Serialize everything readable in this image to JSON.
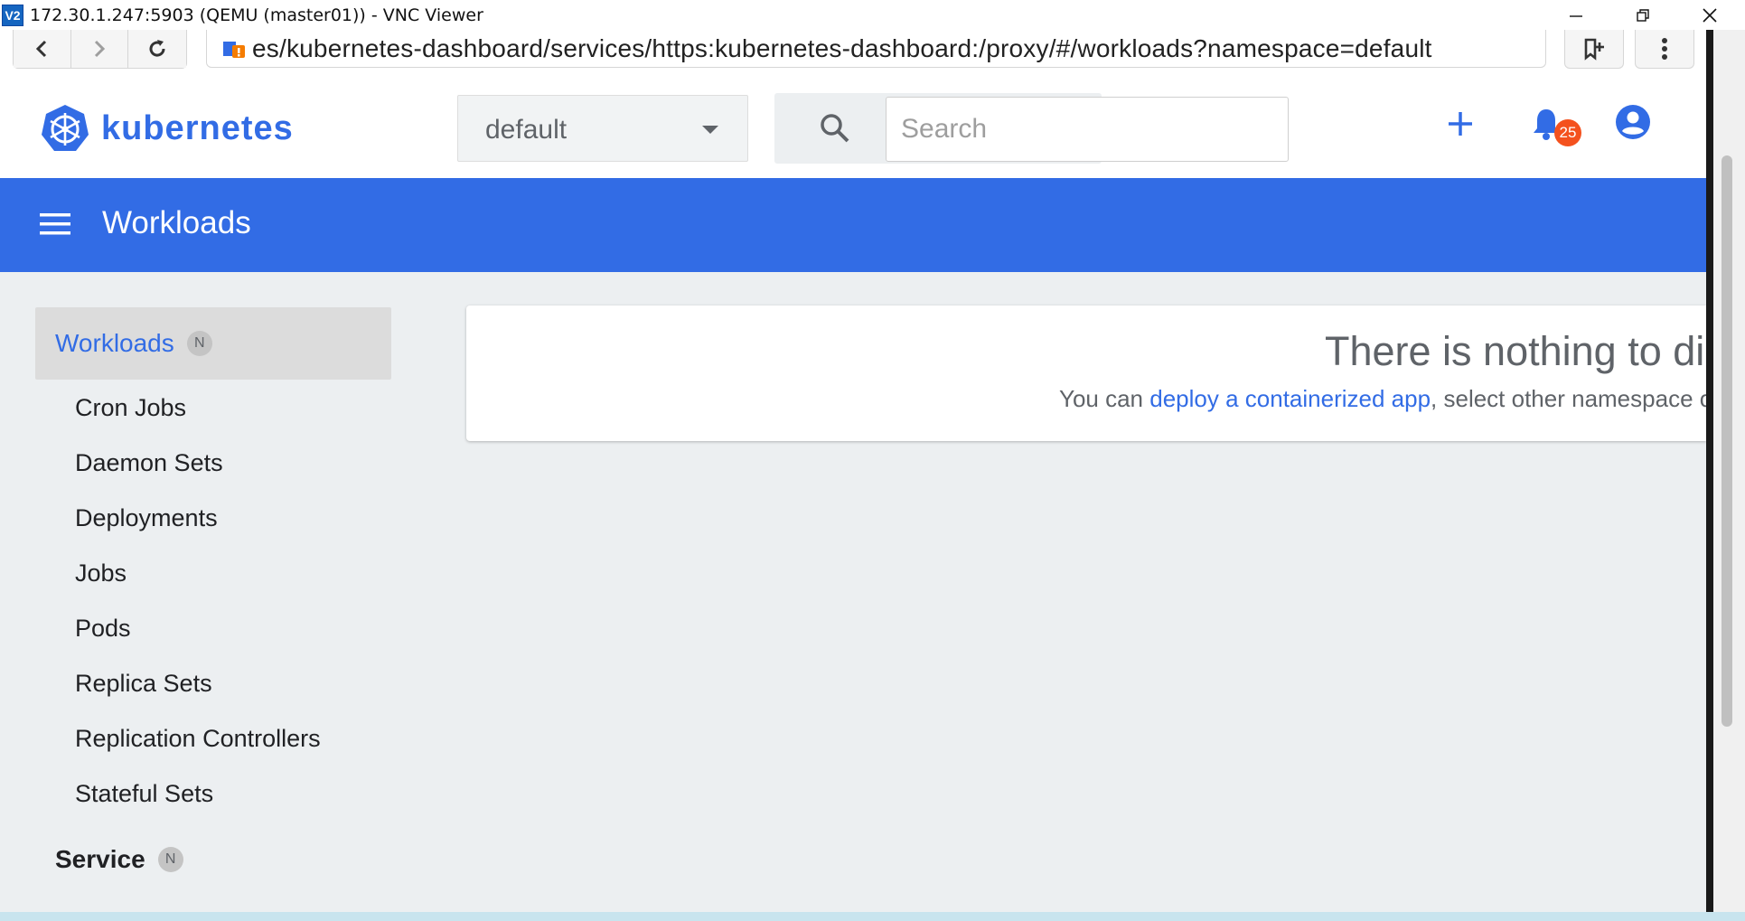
{
  "window": {
    "app_icon_text": "V2",
    "title": "172.30.1.247:5903 (QEMU (master01)) - VNC Viewer"
  },
  "browser": {
    "url": "es/kubernetes-dashboard/services/https:kubernetes-dashboard:/proxy/#/workloads?namespace=default"
  },
  "header": {
    "brand": "kubernetes",
    "namespace": "default",
    "search_placeholder": "Search",
    "notification_count": "25"
  },
  "toolbar": {
    "title": "Workloads"
  },
  "sidebar": {
    "sections": [
      {
        "label": "Workloads",
        "chip": "N"
      },
      {
        "label": "Service",
        "chip": "N"
      }
    ],
    "items": [
      {
        "label": "Cron Jobs"
      },
      {
        "label": "Daemon Sets"
      },
      {
        "label": "Deployments"
      },
      {
        "label": "Jobs"
      },
      {
        "label": "Pods"
      },
      {
        "label": "Replica Sets"
      },
      {
        "label": "Replication Controllers"
      },
      {
        "label": "Stateful Sets"
      }
    ]
  },
  "empty_state": {
    "title": "There is nothing to di",
    "prefix": "You can ",
    "link": "deploy a containerized app",
    "suffix": ", select other namespace or"
  },
  "colors": {
    "brand": "#326ce5",
    "badge": "#f4511e"
  }
}
